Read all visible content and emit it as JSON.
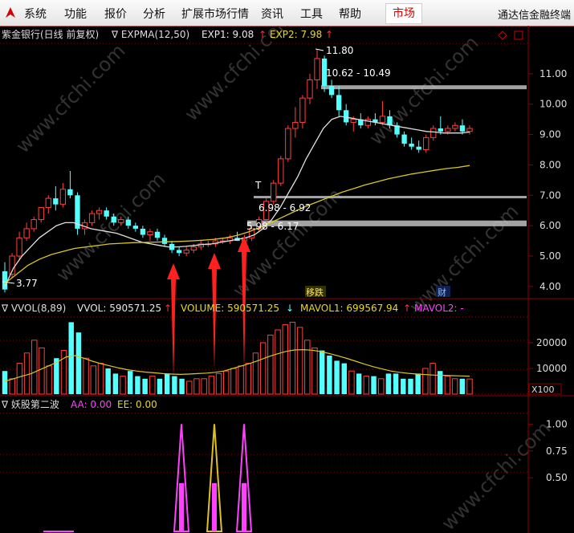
{
  "menu": [
    "系统",
    "功能",
    "报价",
    "分析",
    "扩展市场行情",
    "资讯",
    "工具",
    "帮助"
  ],
  "market_tab": "市场",
  "brand": "通达信金融终端",
  "watermark": "www.cfchi.com",
  "main_panel": {
    "stock": "紫金银行(日线 前复权)",
    "indicator": "∇ EXPMA(12,50)",
    "exp1": "EXP1: 9.08",
    "exp1_arrow": "↑",
    "exp2": "EXP2: 7.98",
    "exp2_arrow": "↑",
    "price_ticks": [
      "11.00",
      "10.00",
      "9.00",
      "8.00",
      "7.00",
      "6.00",
      "5.00",
      "4.00"
    ],
    "high_label": "11.80",
    "low_label": "3.77",
    "gaps": [
      {
        "label": "10.62 - 10.49"
      },
      {
        "label": "6.98 - 6.92"
      },
      {
        "label": "5.98 - 6.17"
      }
    ],
    "t_marker": "T",
    "event_label_1": "移跌",
    "event_label_2": "财",
    "colors": {
      "up": "#ff4040",
      "down": "#54ffff",
      "exp1": "#e0e0e0",
      "exp2": "#d8c820",
      "grid": "#7a0000"
    }
  },
  "volume_panel": {
    "title": "∇ VVOL(8,89)",
    "vol": "VVOL: 590571.25",
    "vol_arrow": "↑",
    "volume": "VOLUME: 590571.25",
    "volume_arrow": "↓",
    "mavol1": "MAVOL1: 699567.94",
    "mavol1_arrow": "↑",
    "mavol2": "MAVOL2: -",
    "ticks": [
      "20000",
      "10000"
    ],
    "unit": "X100"
  },
  "signal_panel": {
    "title": "∇ 妖股第二波",
    "aa": "AA: 0.00",
    "ee": "EE: 0.00",
    "ticks": [
      "1.00",
      "0.75",
      "0.50"
    ]
  },
  "chart_data": {
    "type": "candlestick",
    "candles": [
      [
        4.5,
        4.8,
        3.8,
        3.9
      ],
      [
        4.4,
        5.1,
        4.3,
        5.0
      ],
      [
        5.0,
        5.8,
        4.9,
        5.6
      ],
      [
        5.6,
        6.1,
        5.5,
        5.9
      ],
      [
        5.9,
        6.3,
        5.8,
        6.2
      ],
      [
        6.2,
        6.6,
        6.1,
        6.6
      ],
      [
        6.6,
        7.0,
        6.4,
        6.9
      ],
      [
        6.9,
        7.3,
        6.5,
        6.7
      ],
      [
        6.7,
        7.4,
        6.6,
        7.2
      ],
      [
        7.2,
        7.8,
        6.9,
        7.0
      ],
      [
        7.0,
        7.1,
        5.7,
        5.9
      ],
      [
        5.9,
        6.2,
        5.7,
        6.1
      ],
      [
        6.1,
        6.5,
        6.0,
        6.4
      ],
      [
        6.4,
        6.6,
        6.2,
        6.5
      ],
      [
        6.5,
        6.6,
        6.2,
        6.3
      ],
      [
        6.3,
        6.4,
        6.0,
        6.1
      ],
      [
        6.1,
        6.3,
        6.0,
        6.2
      ],
      [
        6.2,
        6.3,
        5.9,
        6.0
      ],
      [
        6.0,
        6.1,
        5.8,
        5.9
      ],
      [
        5.9,
        6.0,
        5.6,
        5.7
      ],
      [
        5.7,
        5.9,
        5.5,
        5.8
      ],
      [
        5.8,
        5.9,
        5.5,
        5.6
      ],
      [
        5.6,
        5.7,
        5.3,
        5.4
      ],
      [
        5.4,
        5.5,
        5.1,
        5.2
      ],
      [
        5.2,
        5.3,
        5.0,
        5.1
      ],
      [
        5.1,
        5.3,
        5.0,
        5.2
      ],
      [
        5.2,
        5.4,
        5.1,
        5.3
      ],
      [
        5.3,
        5.5,
        5.2,
        5.4
      ],
      [
        5.4,
        5.5,
        5.3,
        5.4
      ],
      [
        5.4,
        5.6,
        5.3,
        5.5
      ],
      [
        5.5,
        5.6,
        5.4,
        5.5
      ],
      [
        5.5,
        5.7,
        5.4,
        5.6
      ],
      [
        5.6,
        5.8,
        5.5,
        5.5
      ],
      [
        5.5,
        5.7,
        5.4,
        5.6
      ],
      [
        5.6,
        6.0,
        5.5,
        5.9
      ],
      [
        5.9,
        6.3,
        5.8,
        6.2
      ],
      [
        6.2,
        6.9,
        6.1,
        6.8
      ],
      [
        6.8,
        7.5,
        6.7,
        7.4
      ],
      [
        7.4,
        8.3,
        7.3,
        8.2
      ],
      [
        8.2,
        9.3,
        8.1,
        9.2
      ],
      [
        9.2,
        9.9,
        8.9,
        9.4
      ],
      [
        9.4,
        10.3,
        9.2,
        10.2
      ],
      [
        10.2,
        11.0,
        10.0,
        10.8
      ],
      [
        10.8,
        11.8,
        10.5,
        11.5
      ],
      [
        11.5,
        11.6,
        10.4,
        10.6
      ],
      [
        10.6,
        10.8,
        10.2,
        10.3
      ],
      [
        10.3,
        10.6,
        9.6,
        9.8
      ],
      [
        9.8,
        10.0,
        9.3,
        9.4
      ],
      [
        9.4,
        9.6,
        9.1,
        9.5
      ],
      [
        9.5,
        9.7,
        9.2,
        9.3
      ],
      [
        9.3,
        9.6,
        9.2,
        9.5
      ],
      [
        9.5,
        9.7,
        9.3,
        9.4
      ],
      [
        9.4,
        10.1,
        9.3,
        9.6
      ],
      [
        9.6,
        9.8,
        9.2,
        9.3
      ],
      [
        9.3,
        9.4,
        8.9,
        9.0
      ],
      [
        9.0,
        9.1,
        8.6,
        8.7
      ],
      [
        8.7,
        8.9,
        8.5,
        8.6
      ],
      [
        8.6,
        8.8,
        8.4,
        8.5
      ],
      [
        8.5,
        9.0,
        8.4,
        8.9
      ],
      [
        8.9,
        9.3,
        8.8,
        9.2
      ],
      [
        9.2,
        9.6,
        9.0,
        9.1
      ],
      [
        9.1,
        9.3,
        9.0,
        9.2
      ],
      [
        9.2,
        9.4,
        9.1,
        9.3
      ],
      [
        9.3,
        9.5,
        9.0,
        9.1
      ],
      [
        9.1,
        9.3,
        9.0,
        9.2
      ]
    ],
    "exp1": [
      4.0,
      4.6,
      5.0,
      5.3,
      5.6,
      5.8,
      6.0,
      6.1,
      6.1,
      6.0,
      5.9,
      5.85,
      5.8,
      5.75,
      5.65,
      5.55,
      5.45,
      5.4,
      5.35,
      5.3,
      5.3,
      5.32,
      5.35,
      5.38,
      5.4,
      5.45,
      5.5,
      5.55,
      5.6,
      5.7,
      5.9,
      6.2,
      6.6,
      7.1,
      7.6,
      8.2,
      8.7,
      9.2,
      9.5,
      9.6,
      9.55,
      9.5,
      9.45,
      9.4,
      9.35,
      9.3,
      9.25,
      9.2,
      9.15,
      9.1,
      9.08,
      9.05,
      9.05,
      9.05,
      9.08
    ],
    "exp2": [
      4.1,
      4.4,
      4.7,
      4.9,
      5.05,
      5.15,
      5.25,
      5.3,
      5.35,
      5.4,
      5.42,
      5.44,
      5.45,
      5.46,
      5.47,
      5.48,
      5.5,
      5.52,
      5.55,
      5.6,
      5.68,
      5.8,
      5.95,
      6.12,
      6.3,
      6.48,
      6.65,
      6.8,
      6.95,
      7.1,
      7.22,
      7.34,
      7.44,
      7.54,
      7.62,
      7.7,
      7.76,
      7.82,
      7.88,
      7.92,
      7.98
    ],
    "gaps": [
      [
        10.49,
        10.62
      ],
      [
        6.92,
        6.98
      ],
      [
        5.98,
        6.17
      ]
    ],
    "ylim": [
      3.6,
      12.0
    ],
    "volume": [
      9000,
      6000,
      12000,
      16000,
      21000,
      18000,
      11000,
      14000,
      17000,
      28000,
      24000,
      14000,
      11000,
      12000,
      10000,
      8000,
      7000,
      9000,
      7000,
      6000,
      7000,
      6000,
      8000,
      7000,
      6000,
      5000,
      6000,
      6000,
      7000,
      8000,
      9000,
      10000,
      11000,
      12000,
      16000,
      20000,
      23000,
      25000,
      27000,
      28000,
      26000,
      21000,
      18000,
      17000,
      15000,
      13000,
      12000,
      9000,
      8000,
      7000,
      7000,
      6000,
      8000,
      8000,
      6000,
      6000,
      8000,
      10000,
      12000,
      9000,
      7000,
      6000,
      6000,
      5906
    ],
    "volume_ylim": [
      0,
      30000
    ],
    "mavol": [
      5000,
      6000,
      7000,
      8000,
      9500,
      11000,
      12500,
      14500,
      15000,
      14000,
      12800,
      11800,
      11000,
      10200,
      9500,
      9000,
      8600,
      8300,
      8000,
      7800,
      7700,
      7800,
      8000,
      8200,
      8500,
      9000,
      10000,
      11000,
      12000,
      13200,
      14500,
      15600,
      16600,
      17200,
      17300,
      17100,
      16600,
      15800,
      14900,
      13900,
      12800,
      11700,
      10700,
      9800,
      9000,
      8500,
      8100,
      7800,
      7600,
      7400,
      7300,
      7200,
      7100,
      7000
    ],
    "volume_ylim_label": "20000 / 10000",
    "signal_spikes": [
      {
        "peak": 1.0,
        "color": "#ff40ff"
      },
      {
        "peak": 1.0,
        "color": "#e0c020"
      },
      {
        "peak": 1.0,
        "color": "#ff40ff"
      }
    ],
    "signal_ylim": [
      0.0,
      1.1
    ]
  }
}
